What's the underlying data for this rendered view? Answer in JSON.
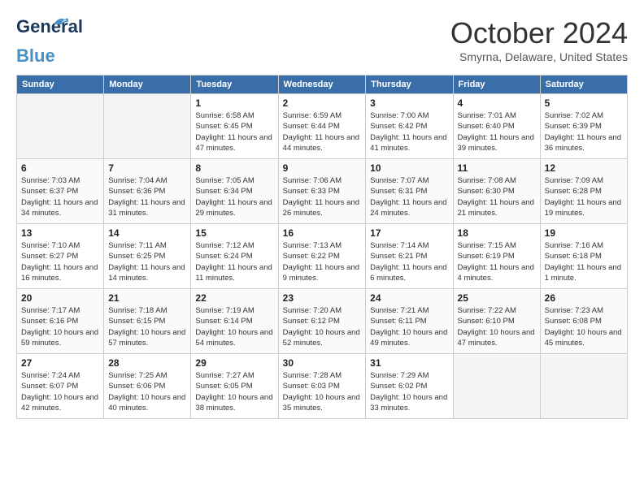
{
  "logo": {
    "general": "General",
    "blue": "Blue"
  },
  "header": {
    "month": "October 2024",
    "location": "Smyrna, Delaware, United States"
  },
  "weekdays": [
    "Sunday",
    "Monday",
    "Tuesday",
    "Wednesday",
    "Thursday",
    "Friday",
    "Saturday"
  ],
  "weeks": [
    [
      {
        "day": "",
        "info": ""
      },
      {
        "day": "",
        "info": ""
      },
      {
        "day": "1",
        "info": "Sunrise: 6:58 AM\nSunset: 6:45 PM\nDaylight: 11 hours and 47 minutes."
      },
      {
        "day": "2",
        "info": "Sunrise: 6:59 AM\nSunset: 6:44 PM\nDaylight: 11 hours and 44 minutes."
      },
      {
        "day": "3",
        "info": "Sunrise: 7:00 AM\nSunset: 6:42 PM\nDaylight: 11 hours and 41 minutes."
      },
      {
        "day": "4",
        "info": "Sunrise: 7:01 AM\nSunset: 6:40 PM\nDaylight: 11 hours and 39 minutes."
      },
      {
        "day": "5",
        "info": "Sunrise: 7:02 AM\nSunset: 6:39 PM\nDaylight: 11 hours and 36 minutes."
      }
    ],
    [
      {
        "day": "6",
        "info": "Sunrise: 7:03 AM\nSunset: 6:37 PM\nDaylight: 11 hours and 34 minutes."
      },
      {
        "day": "7",
        "info": "Sunrise: 7:04 AM\nSunset: 6:36 PM\nDaylight: 11 hours and 31 minutes."
      },
      {
        "day": "8",
        "info": "Sunrise: 7:05 AM\nSunset: 6:34 PM\nDaylight: 11 hours and 29 minutes."
      },
      {
        "day": "9",
        "info": "Sunrise: 7:06 AM\nSunset: 6:33 PM\nDaylight: 11 hours and 26 minutes."
      },
      {
        "day": "10",
        "info": "Sunrise: 7:07 AM\nSunset: 6:31 PM\nDaylight: 11 hours and 24 minutes."
      },
      {
        "day": "11",
        "info": "Sunrise: 7:08 AM\nSunset: 6:30 PM\nDaylight: 11 hours and 21 minutes."
      },
      {
        "day": "12",
        "info": "Sunrise: 7:09 AM\nSunset: 6:28 PM\nDaylight: 11 hours and 19 minutes."
      }
    ],
    [
      {
        "day": "13",
        "info": "Sunrise: 7:10 AM\nSunset: 6:27 PM\nDaylight: 11 hours and 16 minutes."
      },
      {
        "day": "14",
        "info": "Sunrise: 7:11 AM\nSunset: 6:25 PM\nDaylight: 11 hours and 14 minutes."
      },
      {
        "day": "15",
        "info": "Sunrise: 7:12 AM\nSunset: 6:24 PM\nDaylight: 11 hours and 11 minutes."
      },
      {
        "day": "16",
        "info": "Sunrise: 7:13 AM\nSunset: 6:22 PM\nDaylight: 11 hours and 9 minutes."
      },
      {
        "day": "17",
        "info": "Sunrise: 7:14 AM\nSunset: 6:21 PM\nDaylight: 11 hours and 6 minutes."
      },
      {
        "day": "18",
        "info": "Sunrise: 7:15 AM\nSunset: 6:19 PM\nDaylight: 11 hours and 4 minutes."
      },
      {
        "day": "19",
        "info": "Sunrise: 7:16 AM\nSunset: 6:18 PM\nDaylight: 11 hours and 1 minute."
      }
    ],
    [
      {
        "day": "20",
        "info": "Sunrise: 7:17 AM\nSunset: 6:16 PM\nDaylight: 10 hours and 59 minutes."
      },
      {
        "day": "21",
        "info": "Sunrise: 7:18 AM\nSunset: 6:15 PM\nDaylight: 10 hours and 57 minutes."
      },
      {
        "day": "22",
        "info": "Sunrise: 7:19 AM\nSunset: 6:14 PM\nDaylight: 10 hours and 54 minutes."
      },
      {
        "day": "23",
        "info": "Sunrise: 7:20 AM\nSunset: 6:12 PM\nDaylight: 10 hours and 52 minutes."
      },
      {
        "day": "24",
        "info": "Sunrise: 7:21 AM\nSunset: 6:11 PM\nDaylight: 10 hours and 49 minutes."
      },
      {
        "day": "25",
        "info": "Sunrise: 7:22 AM\nSunset: 6:10 PM\nDaylight: 10 hours and 47 minutes."
      },
      {
        "day": "26",
        "info": "Sunrise: 7:23 AM\nSunset: 6:08 PM\nDaylight: 10 hours and 45 minutes."
      }
    ],
    [
      {
        "day": "27",
        "info": "Sunrise: 7:24 AM\nSunset: 6:07 PM\nDaylight: 10 hours and 42 minutes."
      },
      {
        "day": "28",
        "info": "Sunrise: 7:25 AM\nSunset: 6:06 PM\nDaylight: 10 hours and 40 minutes."
      },
      {
        "day": "29",
        "info": "Sunrise: 7:27 AM\nSunset: 6:05 PM\nDaylight: 10 hours and 38 minutes."
      },
      {
        "day": "30",
        "info": "Sunrise: 7:28 AM\nSunset: 6:03 PM\nDaylight: 10 hours and 35 minutes."
      },
      {
        "day": "31",
        "info": "Sunrise: 7:29 AM\nSunset: 6:02 PM\nDaylight: 10 hours and 33 minutes."
      },
      {
        "day": "",
        "info": ""
      },
      {
        "day": "",
        "info": ""
      }
    ]
  ]
}
